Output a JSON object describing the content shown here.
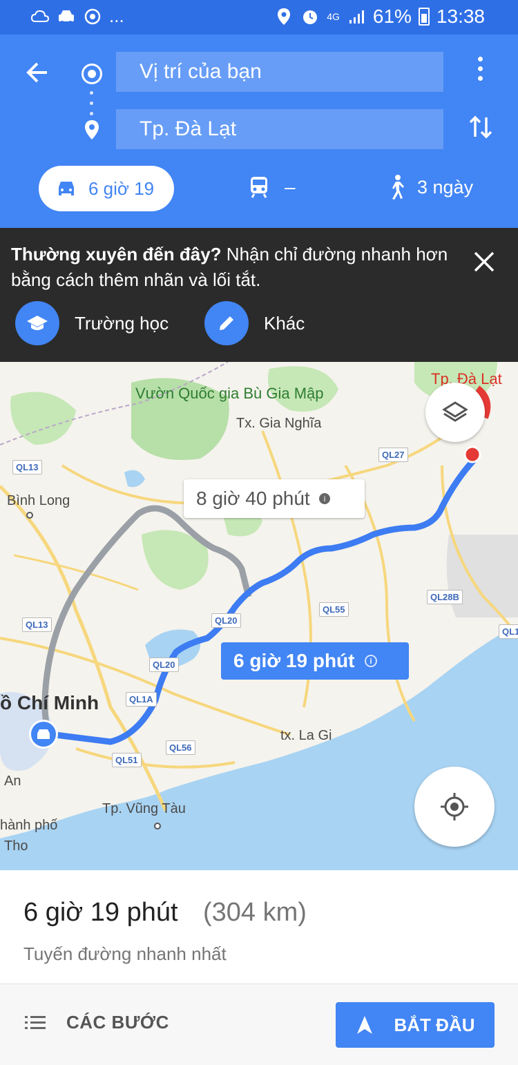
{
  "status_bar": {
    "dots": "...",
    "network": "4G",
    "battery_pct": "61%",
    "time": "13:38"
  },
  "route_header": {
    "origin": "Vị trí của bạn",
    "destination": "Tp. Đà Lạt"
  },
  "travel_modes": {
    "driving": "6 giờ 19",
    "transit": "–",
    "walking": "3 ngày"
  },
  "promo": {
    "bold": "Thường xuyên đến đây?",
    "text": " Nhận chỉ đường nhanh hơn bằng cách thêm nhãn và lối tắt.",
    "chips": [
      {
        "label": "Trường học",
        "icon": "school-icon"
      },
      {
        "label": "Khác",
        "icon": "pencil-icon"
      }
    ]
  },
  "map": {
    "destination_label": "Tp. Đà Lạt",
    "alt_route_time": "8 giờ 40 phút",
    "main_route_time": "6 giờ 19 phút",
    "places": {
      "park": "Vườn Quốc gia Bù Gia Mập",
      "gia_nghia": "Tx. Gia Nghĩa",
      "binh_long": "Bình Long",
      "hcm": "ồ Chí Minh",
      "la_gi": "tx. La Gi",
      "vung_tau": "Tp. Vũng Tàu",
      "an": "An",
      "thanh_pho": "hành phố",
      "tho": "Tho"
    },
    "roads": [
      "QL13",
      "QL27",
      "QL28B",
      "QL55",
      "QL20",
      "QL20",
      "QL1A",
      "QL56",
      "QL51",
      "QL13",
      "QL1"
    ],
    "colors": {
      "route_main": "#4285f4",
      "route_alt": "#9aa0a6",
      "water": "#a8d3f3",
      "park": "#b7dfa8"
    }
  },
  "summary": {
    "duration": "6 giờ 19 phút",
    "distance": "(304 km)",
    "subtitle": "Tuyến đường nhanh nhất"
  },
  "actions": {
    "steps": "CÁC BƯỚC",
    "start": "BẮT ĐẦU"
  }
}
